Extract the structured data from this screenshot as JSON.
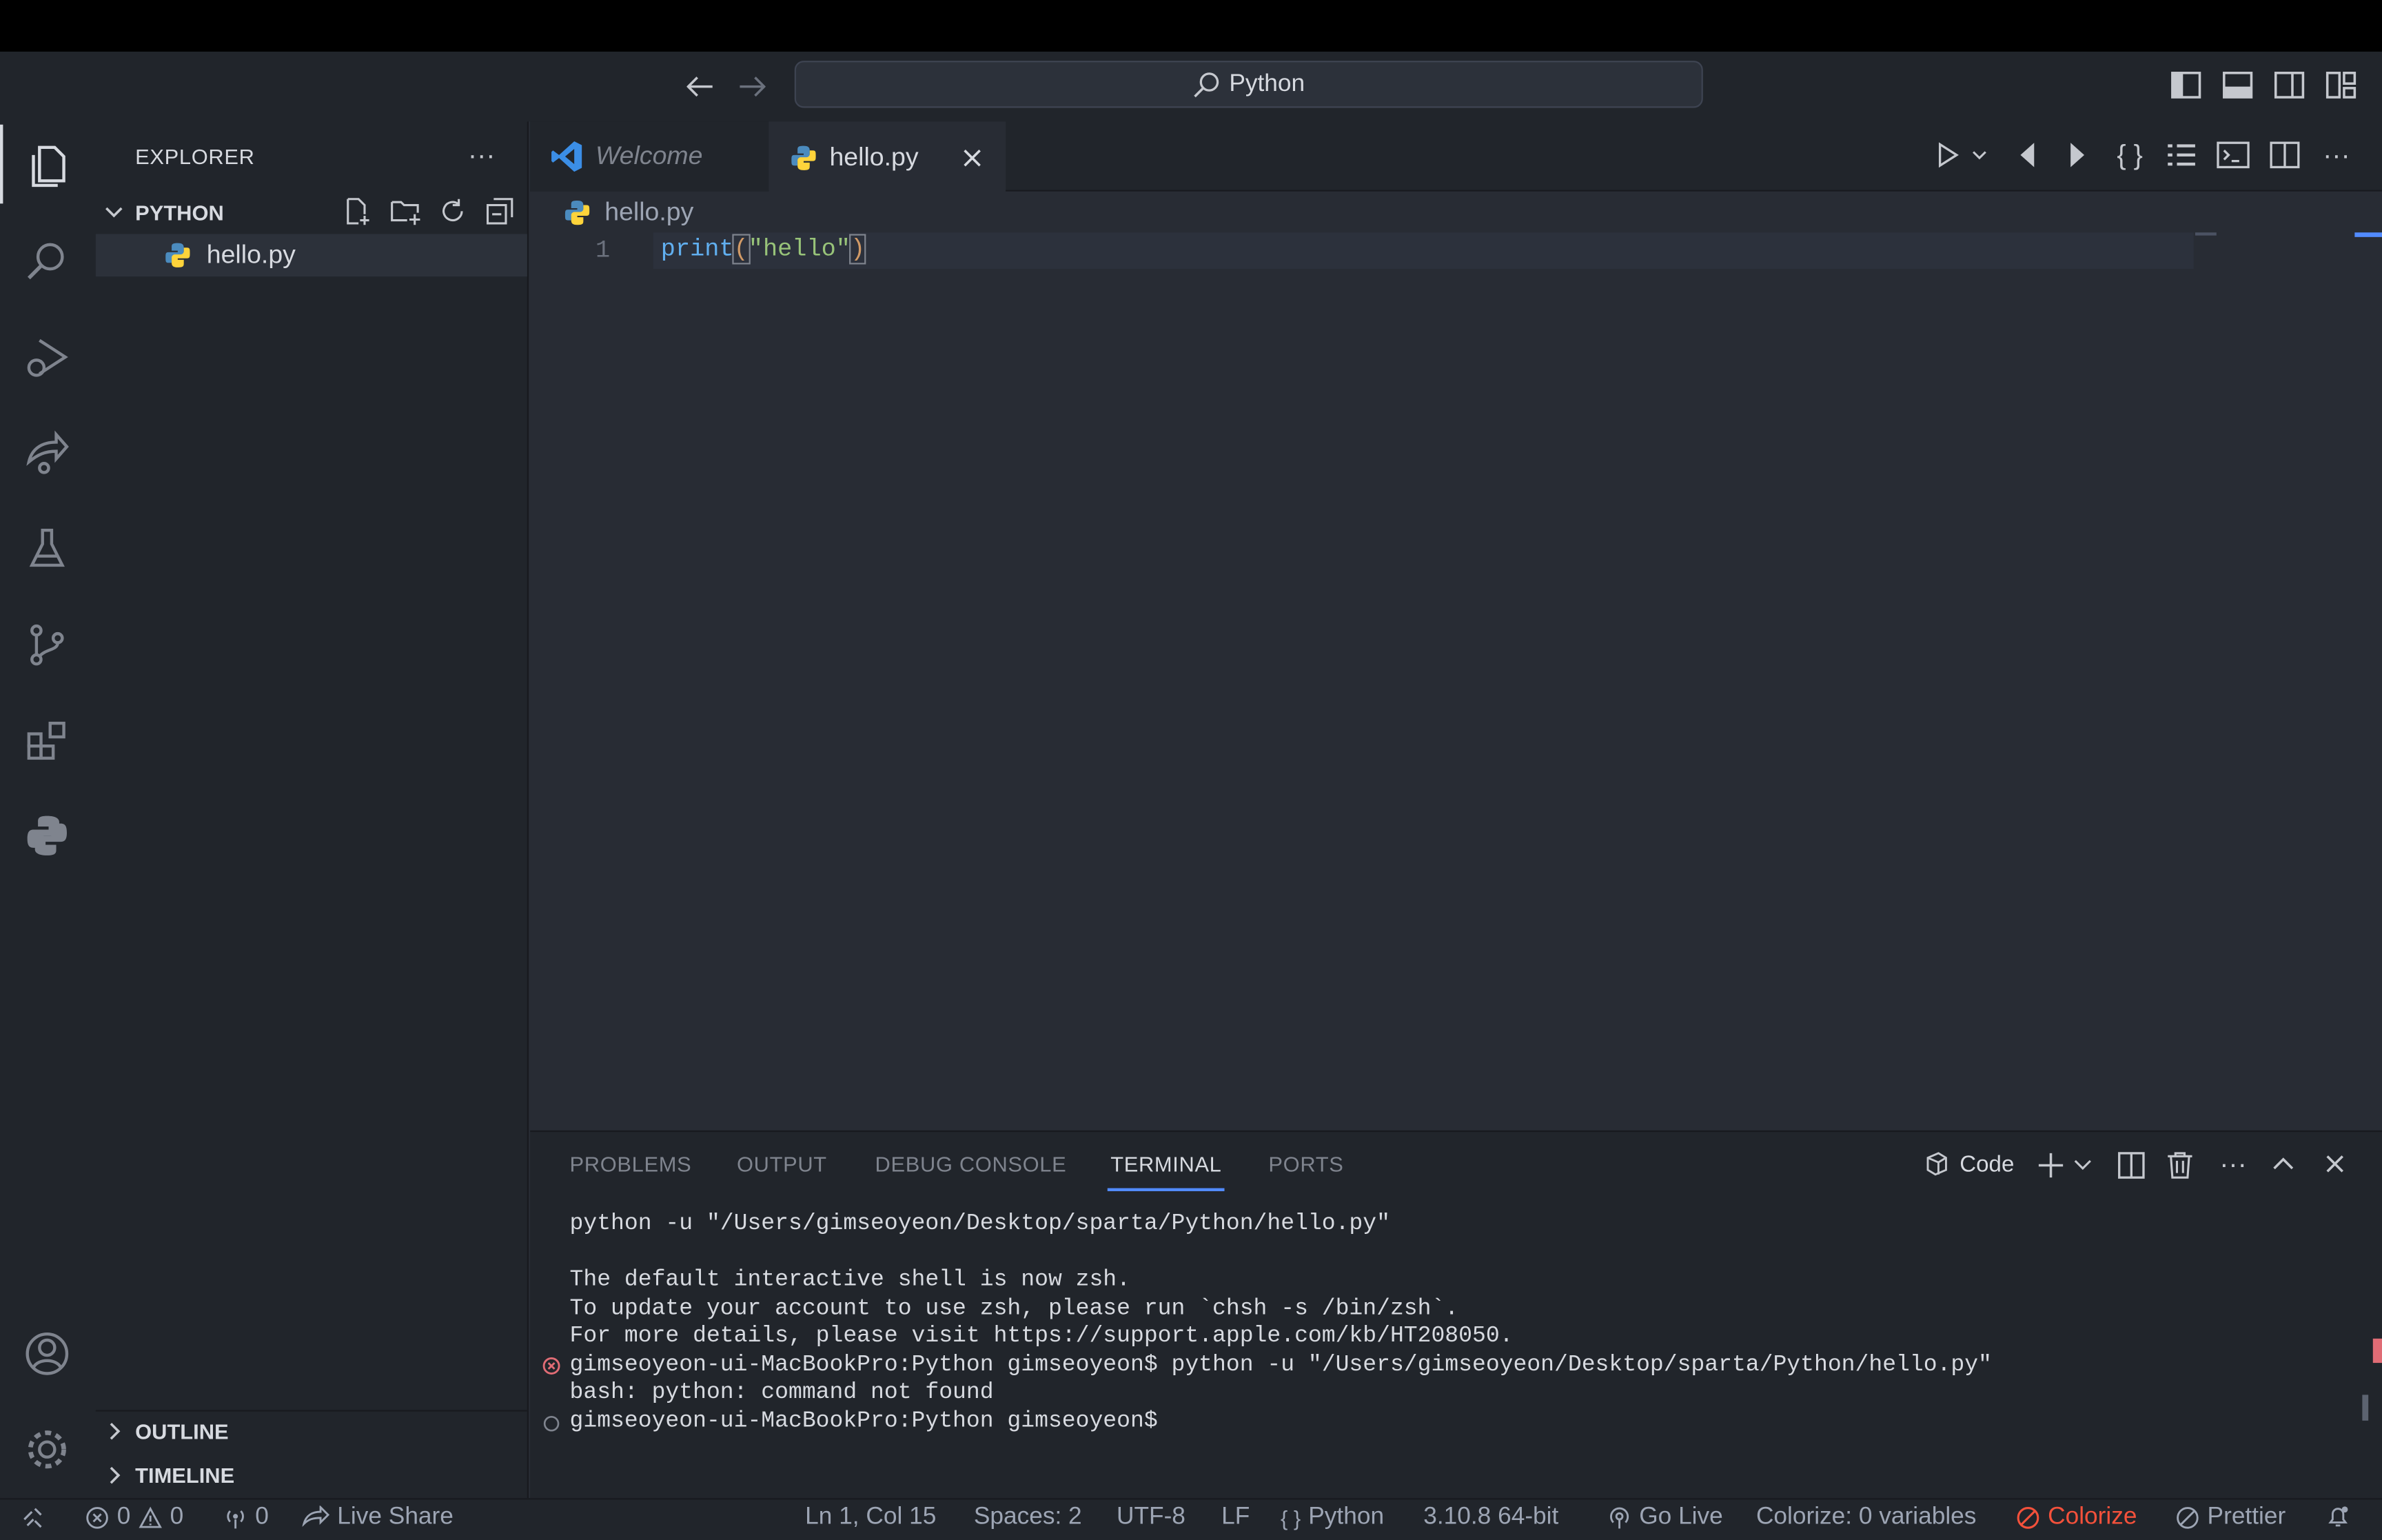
{
  "window": {
    "search_text": "Python"
  },
  "sidebar": {
    "title": "EXPLORER",
    "folder": "PYTHON",
    "files": [
      {
        "name": "hello.py"
      }
    ],
    "outline": "OUTLINE",
    "timeline": "TIMELINE"
  },
  "tabs": [
    {
      "label": "Welcome",
      "active": false
    },
    {
      "label": "hello.py",
      "active": true
    }
  ],
  "editor": {
    "breadcrumb": "hello.py",
    "line_number": "1",
    "code": {
      "fn": "print",
      "open": "(",
      "str": "\"hello\"",
      "close": ")"
    }
  },
  "panel": {
    "tabs": [
      "PROBLEMS",
      "OUTPUT",
      "DEBUG CONSOLE",
      "TERMINAL",
      "PORTS"
    ],
    "active_tab": "TERMINAL",
    "terminal_name": "Code",
    "lines": [
      "python -u \"/Users/gimseoyeon/Desktop/sparta/Python/hello.py\"",
      "",
      "The default interactive shell is now zsh.",
      "To update your account to use zsh, please run `chsh -s /bin/zsh`.",
      "For more details, please visit https://support.apple.com/kb/HT208050.",
      "gimseoyeon-ui-MacBookPro:Python gimseoyeon$ python -u \"/Users/gimseoyeon/Desktop/sparta/Python/hello.py\"",
      "bash: python: command not found",
      "gimseoyeon-ui-MacBookPro:Python gimseoyeon$"
    ]
  },
  "status": {
    "errors": "0",
    "warnings": "0",
    "ports": "0",
    "live_share": "Live Share",
    "position": "Ln 1, Col 15",
    "spaces": "Spaces: 2",
    "encoding": "UTF-8",
    "eol": "LF",
    "language": "Python",
    "interpreter": "3.10.8 64-bit",
    "go_live": "Go Live",
    "colorize_vars": "Colorize: 0 variables",
    "colorize": "Colorize",
    "prettier": "Prettier"
  },
  "colors": {
    "accent": "#528bff",
    "error": "#e06c75",
    "colorize": "#f4513b",
    "string": "#98c379",
    "function": "#61afef"
  }
}
